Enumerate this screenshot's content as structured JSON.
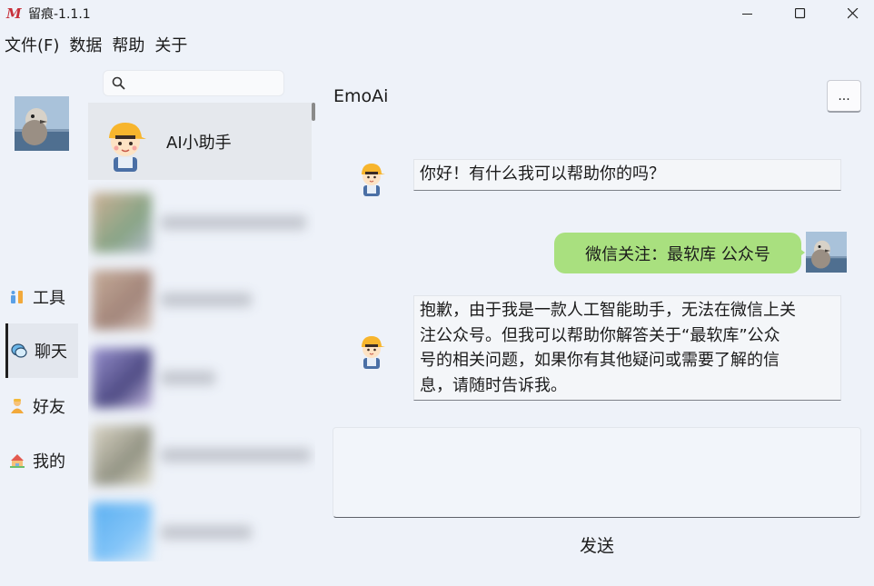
{
  "window": {
    "title": "留痕-1.1.1",
    "logo_letter": "M",
    "controls": {
      "minimize": "minimize-icon",
      "maximize": "maximize-icon",
      "close": "close-icon"
    }
  },
  "menu": [
    "文件(F)",
    "数据",
    "帮助",
    "关于"
  ],
  "nav": {
    "items": [
      {
        "label": "工具",
        "icon": "tools-icon"
      },
      {
        "label": "聊天",
        "icon": "chat-icon",
        "active": true
      },
      {
        "label": "好友",
        "icon": "friend-icon"
      },
      {
        "label": "我的",
        "icon": "home-icon"
      }
    ]
  },
  "search": {
    "placeholder": "",
    "value": ""
  },
  "contacts": [
    {
      "name": "AI小助手",
      "selected": true
    }
  ],
  "chat": {
    "title": "EmoAi",
    "more_label": "...",
    "messages": [
      {
        "from": "ai",
        "text": "你好！有什么我可以帮助你的吗？"
      },
      {
        "from": "self",
        "text": "微信关注：最软库  公众号"
      },
      {
        "from": "ai",
        "lines": [
          "抱歉，由于我是一款人工智能助手，无法在微信上关",
          "注公众号。但我可以帮助你解答关于“最软库”公众",
          "号的相关问题，如果你有其他疑问或需要了解的信",
          "息，请随时告诉我。"
        ]
      }
    ],
    "compose_value": "",
    "send_label": "发送"
  },
  "colors": {
    "accent_green": "#a9e07f",
    "background": "#eef2f9",
    "logo_red": "#c7303a"
  }
}
